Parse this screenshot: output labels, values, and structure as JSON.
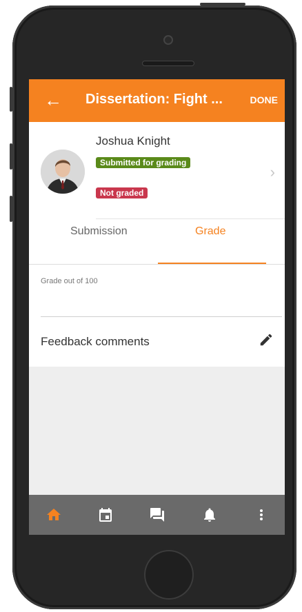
{
  "header": {
    "back_icon": "arrow-left-icon",
    "title": "Dissertation: Fight ...",
    "done_label": "DONE"
  },
  "student": {
    "name": "Joshua Knight",
    "status_badges": [
      {
        "label": "Submitted for grading",
        "color": "#5a8a1a"
      },
      {
        "label": "Not graded",
        "color": "#c9374d"
      }
    ]
  },
  "tabs": [
    {
      "label": "Submission",
      "active": false
    },
    {
      "label": "Grade",
      "active": true
    }
  ],
  "grade": {
    "label": "Grade out of 100",
    "value": ""
  },
  "feedback": {
    "label": "Feedback comments",
    "icon": "pencil-icon"
  },
  "bottom_nav": [
    {
      "icon": "home-icon",
      "active": true
    },
    {
      "icon": "calendar-icon",
      "active": false
    },
    {
      "icon": "messages-icon",
      "active": false
    },
    {
      "icon": "bell-icon",
      "active": false
    },
    {
      "icon": "more-vertical-icon",
      "active": false
    }
  ],
  "colors": {
    "accent": "#f58220",
    "nav_bg": "#6a6a6a"
  }
}
